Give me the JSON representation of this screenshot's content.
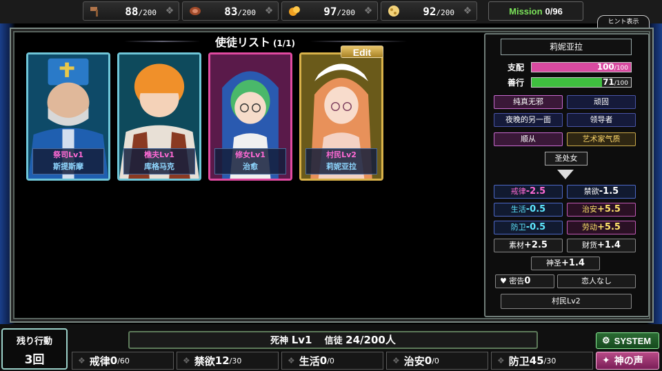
{
  "resources": [
    {
      "icon": "hammer-icon",
      "value": "88",
      "max": "/200"
    },
    {
      "icon": "meat-icon",
      "value": "83",
      "max": "/200"
    },
    {
      "icon": "coins-icon",
      "value": "97",
      "max": "/200"
    },
    {
      "icon": "cheese-icon",
      "value": "92",
      "max": "/200"
    }
  ],
  "mission": {
    "label": "Mission",
    "value": "0/96"
  },
  "hint_button": "ヒント表示",
  "panel": {
    "title": "使徒リスト",
    "count": "(1/1)"
  },
  "edit_label": "Edit",
  "cards": [
    {
      "line1": "祭司Lv1",
      "line2": "斯提斯摩",
      "border": "#6fc6d8"
    },
    {
      "line1": "樵夫Lv1",
      "line2": "库格马克",
      "border": "#6fc6d8"
    },
    {
      "line1": "修女Lv1",
      "line2": "治愈",
      "border": "#e04aa0"
    },
    {
      "line1": "村民Lv2",
      "line2": "莉妮亚拉",
      "border": "#d9b24a"
    }
  ],
  "status": {
    "name": "莉妮亚拉",
    "bars": [
      {
        "key": "支配",
        "value": "100",
        "max": "/100",
        "fraction": 1.0,
        "color": "#d84aa0"
      },
      {
        "key": "善行",
        "value": "71",
        "max": "/100",
        "fraction": 0.71,
        "color": "#3fbf3f"
      }
    ],
    "traits": [
      {
        "text": "纯真无邪",
        "style": "pink"
      },
      {
        "text": "顽固",
        "style": "navy"
      },
      {
        "text": "夜晚的另一面",
        "style": "navy"
      },
      {
        "text": "领导者",
        "style": "navy"
      },
      {
        "text": "顺从",
        "style": "pink"
      },
      {
        "text": "艺术家气质",
        "style": "gold"
      }
    ],
    "saint": "圣处女",
    "modifiers": [
      {
        "key": "戒律",
        "value": "-2.5",
        "style": "mod-blue",
        "color": "c-pink"
      },
      {
        "key": "禁欲",
        "value": "-1.5",
        "style": "mod-blue",
        "color": "c-white"
      },
      {
        "key": "生活",
        "value": "-0.5",
        "style": "mod-blue",
        "color": "c-cyan"
      },
      {
        "key": "治安",
        "value": "+5.5",
        "style": "mod-pink",
        "color": "c-yellow"
      },
      {
        "key": "防卫",
        "value": "-0.5",
        "style": "mod-blue",
        "color": "c-cyan"
      },
      {
        "key": "劳动",
        "value": "+5.5",
        "style": "mod-pink",
        "color": "c-yellow"
      },
      {
        "key": "素材",
        "value": "+2.5",
        "style": "gray",
        "color": "c-white"
      },
      {
        "key": "财货",
        "value": "+1.4",
        "style": "gray",
        "color": "c-white"
      }
    ],
    "holy": {
      "key": "神圣",
      "value": "+1.4"
    },
    "secret": {
      "label": "密告",
      "value": "0"
    },
    "lover": "恋人なし",
    "rank": "村民Lv2"
  },
  "bottom": {
    "remain_title": "残り行動",
    "remain_value": "3回",
    "god": {
      "name": "死神",
      "level": "Lv1",
      "believers_label": "信徒",
      "believers": "24/200人"
    },
    "stats": [
      {
        "key": "戒律",
        "value": "0",
        "max": "/60"
      },
      {
        "key": "禁欲",
        "value": "12",
        "max": "/30"
      },
      {
        "key": "生活",
        "value": "0",
        "max": "/0"
      },
      {
        "key": "治安",
        "value": "0",
        "max": "/0"
      },
      {
        "key": "防卫",
        "value": "45",
        "max": "/30"
      }
    ],
    "system_label": "SYSTEM",
    "voice_label": "神の声"
  }
}
